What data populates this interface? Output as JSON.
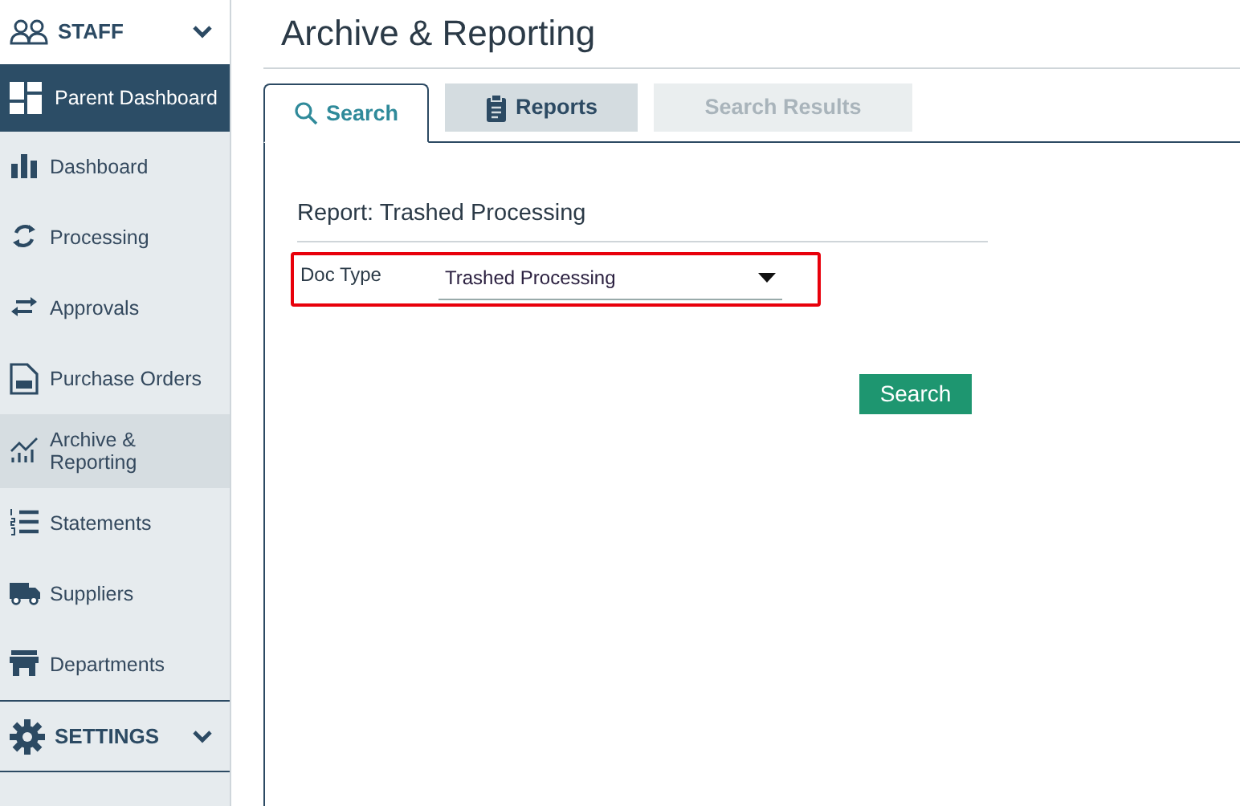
{
  "sidebar": {
    "staff_header": {
      "label": "STAFF",
      "expanded": true
    },
    "parent_dashboard": {
      "label": "Parent Dashboard"
    },
    "items": [
      {
        "label": "Dashboard",
        "selected": false
      },
      {
        "label": "Processing",
        "selected": false
      },
      {
        "label": "Approvals",
        "selected": false
      },
      {
        "label": "Purchase Orders",
        "selected": false
      },
      {
        "label": "Archive & Reporting",
        "selected": true
      },
      {
        "label": "Statements",
        "selected": false
      },
      {
        "label": "Suppliers",
        "selected": false
      },
      {
        "label": "Departments",
        "selected": false
      }
    ],
    "settings_header": {
      "label": "SETTINGS",
      "expanded": false
    }
  },
  "page": {
    "title": "Archive & Reporting",
    "tabs": [
      {
        "label": "Search",
        "selected": true,
        "disabled": false
      },
      {
        "label": "Reports",
        "selected": false,
        "disabled": false
      },
      {
        "label": "Search Results",
        "selected": false,
        "disabled": true
      }
    ],
    "report_title": "Report: Trashed Processing",
    "doc_type": {
      "label": "Doc Type",
      "value": "Trashed Processing",
      "highlighted": true
    },
    "search_button": "Search"
  }
}
